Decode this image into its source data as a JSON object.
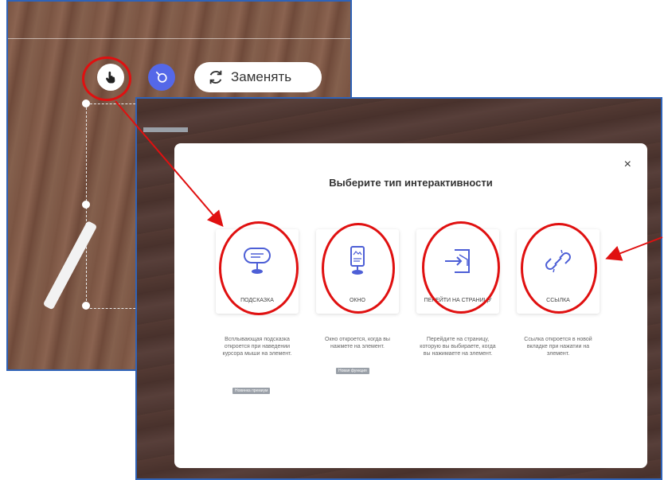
{
  "back_screen": {
    "replace_label": "Заменять",
    "accent": "#5468e8"
  },
  "modal": {
    "title": "Выберите тип интерактивности",
    "close": "×",
    "options": [
      {
        "icon": "tooltip-icon",
        "label": "ПОДСКАЗКА",
        "description": "Всплывающая подсказка откроется при наведении курсора мыши на элемент.",
        "badge": "Новинка премиум"
      },
      {
        "icon": "window-icon",
        "label": "ОКНО",
        "description": "Окно откроется, когда вы нажмете на элемент.",
        "badge": "Новая функция"
      },
      {
        "icon": "go-to-page-icon",
        "label": "ПЕРЕЙТИ НА СТРАНИЦУ",
        "description": "Перейдите на страницу, которую вы выбираете, когда вы нажимаете на элемент.",
        "badge": ""
      },
      {
        "icon": "link-icon",
        "label": "ССЫЛКА",
        "description": "Ссылка откроется в новой вкладке при нажатии на элемент.",
        "badge": ""
      }
    ]
  },
  "colors": {
    "annotation_red": "#e01010",
    "frame_blue": "#2f63b8",
    "icon_blue": "#4d5fd6"
  }
}
